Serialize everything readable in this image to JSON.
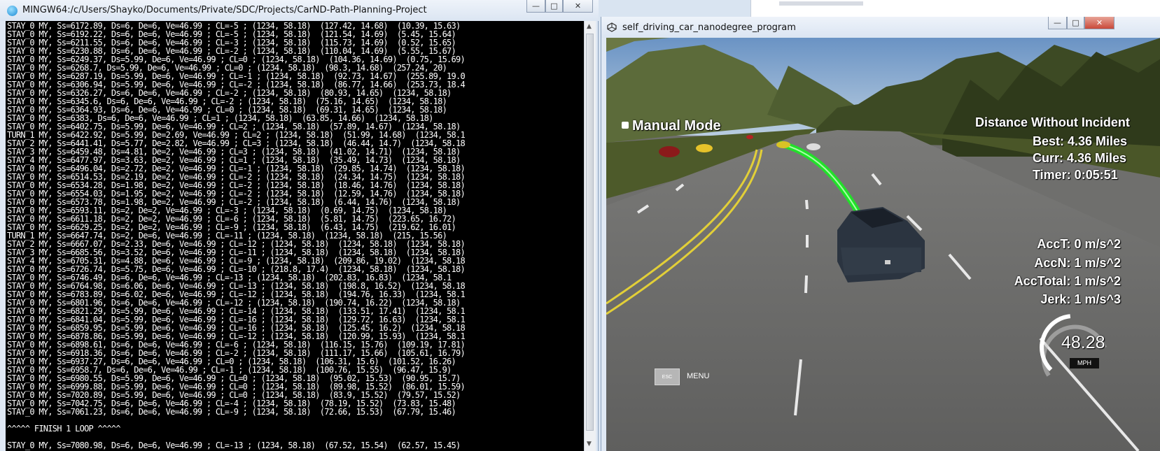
{
  "terminal": {
    "title": "MINGW64:/c/Users/Shayko/Documents/Private/SDC/Projects/CarND-Path-Planning-Project",
    "lines": [
      "STAY_0 MY, Ss=6172.89, Ds=6, De=6, Ve=46.99 ; CL=-5 ; (1234, 58.18)  (127.42, 14.68)  (10.39, 15.63)",
      "STAY_0 MY, Ss=6192.22, Ds=6, De=6, Ve=46.99 ; CL=-5 ; (1234, 58.18)  (121.54, 14.69)  (5.45, 15.64)",
      "STAY_0 MY, Ss=6211.55, Ds=6, De=6, Ve=46.99 ; CL=-3 ; (1234, 58.18)  (115.73, 14.69)  (0.52, 15.65)",
      "STAY_0 MY, Ss=6230.88, Ds=6, De=6, Ve=46.99 ; CL=-2 ; (1234, 58.18)  (110.04, 14.69)  (5.55, 15.67)",
      "STAY_0 MY, Ss=6249.37, Ds=5.99, De=6, Ve=46.99 ; CL=0 ; (1234, 58.18)  (104.36, 14.69)  (0.75, 15.69)",
      "STAY_0 MY, Ss=6268.7, Ds=5.99, De=6, Ve=46.99 ; CL=0 ; (1234, 58.18)  (98.3, 14.68)  (257.24, 20)",
      "STAY_0 MY, Ss=6287.19, Ds=5.99, De=6, Ve=46.99 ; CL=-1 ; (1234, 58.18)  (92.73, 14.67)  (255.89, 19.0",
      "STAY_0 MY, Ss=6306.94, Ds=5.99, De=6, Ve=46.99 ; CL=-2 ; (1234, 58.18)  (86.77, 14.66)  (253.73, 18.4",
      "STAY_0 MY, Ss=6326.27, Ds=6, De=6, Ve=46.99 ; CL=-2 ; (1234, 58.18)  (80.93, 14.65)  (1234, 58.18)",
      "STAY_0 MY, Ss=6345.6, Ds=6, De=6, Ve=46.99 ; CL=-2 ; (1234, 58.18)  (75.16, 14.65)  (1234, 58.18)",
      "STAY_0 MY, Ss=6364.93, Ds=6, De=6, Ve=46.99 ; CL=0 ; (1234, 58.18)  (69.31, 14.65)  (1234, 58.18)",
      "STAY_0 MY, Ss=6383, Ds=6, De=6, Ve=46.99 ; CL=1 ; (1234, 58.18)  (63.85, 14.66)  (1234, 58.18)",
      "STAY_0 MY, Ss=6402.75, Ds=5.99, De=6, Ve=46.99 ; CL=2 ; (1234, 58.18)  (57.89, 14.67)  (1234, 58.18)",
      "TURN_1 MY, Ss=6422.92, Ds=5.99, De=2.69, Ve=46.99 ; CL=2 ; (1234, 58.18)  (51.99, 14.68)  (1234, 58.1",
      "STAY_2 MY, Ss=6441.41, Ds=5.77, De=2.82, Ve=46.99 ; CL=3 ; (1234, 58.18)  (46.44, 14.7)  (1234, 58.18",
      "STAY_3 MY, Ss=6459.48, Ds=4.81, De=2, Ve=46.99 ; CL=3 ; (1234, 58.18)  (41.02, 14.71)  (1234, 58.18)",
      "STAY_4 MY, Ss=6477.97, Ds=3.63, De=2, Ve=46.99 ; CL=1 ; (1234, 58.18)  (35.49, 14.73)  (1234, 58.18)",
      "STAY_0 MY, Ss=6496.04, Ds=2.72, De=2, Ve=46.99 ; CL=-1 ; (1234, 58.18)  (29.85, 14.74)  (1234, 58.18)",
      "STAY_0 MY, Ss=6514.53, Ds=2.19, De=2, Ve=46.99 ; CL=-2 ; (1234, 58.18)  (24.34, 14.75)  (1234, 58.18)",
      "STAY_0 MY, Ss=6534.28, Ds=1.98, De=2, Ve=46.99 ; CL=-2 ; (1234, 58.18)  (18.46, 14.76)  (1234, 58.18)",
      "STAY_0 MY, Ss=6554.03, Ds=1.95, De=2, Ve=46.99 ; CL=-2 ; (1234, 58.18)  (12.59, 14.76)  (1234, 58.18)",
      "STAY_0 MY, Ss=6573.78, Ds=1.98, De=2, Ve=46.99 ; CL=-2 ; (1234, 58.18)  (6.44, 14.76)  (1234, 58.18)",
      "STAY_0 MY, Ss=6593.11, Ds=2, De=2, Ve=46.99 ; CL=-3 ; (1234, 58.18)  (0.69, 14.75)  (1234, 58.18)",
      "STAY_0 MY, Ss=6611.18, Ds=2, De=2, Ve=46.99 ; CL=-6 ; (1234, 58.18)  (5.81, 14.75)  (223.65, 16.72)",
      "STAY_0 MY, Ss=6629.25, Ds=2, De=2, Ve=46.99 ; CL=-9 ; (1234, 58.18)  (6.43, 14.75)  (219.62, 16.01)",
      "TURN_1 MY, Ss=6647.74, Ds=2, De=6, Ve=46.99 ; CL=-11 ; (1234, 58.18)  (1234, 58.18)  (215, 15.56)",
      "STAY_2 MY, Ss=6667.07, Ds=2.33, De=6, Ve=46.99 ; CL=-12 ; (1234, 58.18)  (1234, 58.18)  (1234, 58.18)",
      "STAY_3 MY, Ss=6685.56, Ds=3.52, De=6, Ve=46.99 ; CL=-11 ; (1234, 58.18)  (1234, 58.18)  (1234, 58.18)",
      "STAY_4 MY, Ss=6705.31, Ds=4.88, De=6, Ve=46.99 ; CL=-9 ; (1234, 58.18)  (209.86, 19.02)  (1234, 58.18",
      "STAY_0 MY, Ss=6726.74, Ds=5.75, De=6, Ve=46.99 ; CL=-10 ; (218.8, 17.4)  (1234, 58.18)  (1234, 58.18)",
      "STAY_0 MY, Ss=6746.49, Ds=6, De=6, Ve=46.99 ; CL=-13 ; (1234, 58.18)  (202.83, 16.83)  (1234, 58.1",
      "STAY_0 MY, Ss=6764.98, Ds=6.06, De=6, Ve=46.99 ; CL=-13 ; (1234, 58.18)  (198.8, 16.52)  (1234, 58.18",
      "STAY_0 MY, Ss=6783.89, Ds=6.02, De=6, Ve=46.99 ; CL=-12 ; (1234, 58.18)  (194.76, 16.33)  (1234, 58.1",
      "STAY_0 MY, Ss=6801.96, Ds=6, De=6, Ve=46.99 ; CL=-12 ; (1234, 58.18)  (190.74, 16.22)  (1234, 58.18)",
      "STAY_0 MY, Ss=6821.29, Ds=5.99, De=6, Ve=46.99 ; CL=-14 ; (1234, 58.18)  (133.51, 17.41)  (1234, 58.1",
      "STAY_0 MY, Ss=6841.04, Ds=5.99, De=6, Ve=46.99 ; CL=-16 ; (1234, 58.18)  (129.72, 16.63)  (1234, 58.1",
      "STAY_0 MY, Ss=6859.95, Ds=5.99, De=6, Ve=46.99 ; CL=-16 ; (1234, 58.18)  (125.45, 16.2)  (1234, 58.18",
      "STAY_0 MY, Ss=6878.86, Ds=5.99, De=6, Ve=46.99 ; CL=-12 ; (1234, 58.18)  (120.99, 15.93)  (1234, 58.1",
      "STAY_0 MY, Ss=6898.61, Ds=6, De=6, Ve=46.99 ; CL=-6 ; (1234, 58.18)  (116.15, 15.76)  (109.19, 17.81)",
      "STAY_0 MY, Ss=6918.36, Ds=6, De=6, Ve=46.99 ; CL=-2 ; (1234, 58.18)  (111.17, 15.66)  (105.61, 16.79)",
      "STAY_0 MY, Ss=6937.27, Ds=6, De=6, Ve=46.99 ; CL=0 ; (1234, 58.18)  (106.31, 15.6)  (101.52, 16.26)",
      "STAY_0 MY, Ss=6958.7, Ds=6, De=6, Ve=46.99 ; CL=-1 ; (1234, 58.18)  (100.76, 15.55)  (96.47, 15.9)",
      "STAY_0 MY, Ss=6980.55, Ds=5.99, De=6, Ve=46.99 ; CL=0 ; (1234, 58.18)  (95.02, 15.53)  (90.95, 15.7)",
      "STAY_0 MY, Ss=6999.88, Ds=5.99, De=6, Ve=46.99 ; CL=0 ; (1234, 58.18)  (89.98, 15.52)  (86.01, 15.59)",
      "STAY_0 MY, Ss=7020.89, Ds=5.99, De=6, Ve=46.99 ; CL=0 ; (1234, 58.18)  (83.9, 15.52)  (79.57, 15.52)",
      "STAY_0 MY, Ss=7042.75, Ds=6, De=6, Ve=46.99 ; CL=-4 ; (1234, 58.18)  (78.19, 15.52)  (73.83, 15.48)",
      "STAY_0 MY, Ss=7061.23, Ds=6, De=6, Ve=46.99 ; CL=-9 ; (1234, 58.18)  (72.66, 15.53)  (67.79, 15.46)",
      "",
      "^^^^^ FINISH 1 LOOP ^^^^^",
      "",
      "STAY_0 MY, Ss=7080.98, Ds=6, De=6, Ve=46.99 ; CL=-13 ; (1234, 58.18)  (67.52, 15.54)  (62.57, 15.45)"
    ]
  },
  "simulator": {
    "title": "self_driving_car_nanodegree_program",
    "mode": "Manual Mode",
    "distance_title": "Distance Without Incident",
    "best": "Best: 4.36 Miles",
    "curr": "Curr: 4.36 Miles",
    "timer": "Timer: 0:05:51",
    "acc_t": "AccT: 0 m/s^2",
    "acc_n": "AccN: 1 m/s^2",
    "acc_total": "AccTotal: 1 m/s^2",
    "jerk": "Jerk: 1 m/s^3",
    "speed": "48.28",
    "speed_unit": "MPH",
    "speed_fraction": 0.48,
    "esc_label": "ESC",
    "menu_label": "MENU"
  },
  "colors": {
    "terminal_bg": "#000000",
    "terminal_fg": "#ffffff",
    "path_green": "#22e02a",
    "lane_yellow": "#e2cf38",
    "road_gray": "#6f6f6d"
  }
}
